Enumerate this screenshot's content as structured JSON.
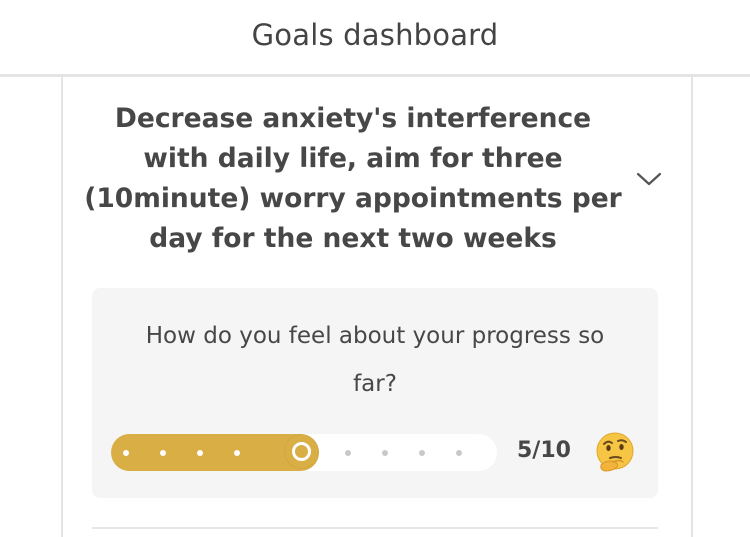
{
  "header": {
    "title": "Goals dashboard"
  },
  "goal": {
    "title_lines": [
      "Decrease anxiety's interference",
      "with daily life, aim for three",
      "(10minute) worry appointments per",
      "day for the next two weeks"
    ],
    "expand_icon": "chevron-down-icon"
  },
  "progress": {
    "question_lines": [
      "How do you feel about your progress so",
      "far?"
    ],
    "value": 5,
    "max": 10,
    "score_label": "5/10",
    "emoji": "thinking-face-icon",
    "accent_color": "#d9ae45"
  }
}
